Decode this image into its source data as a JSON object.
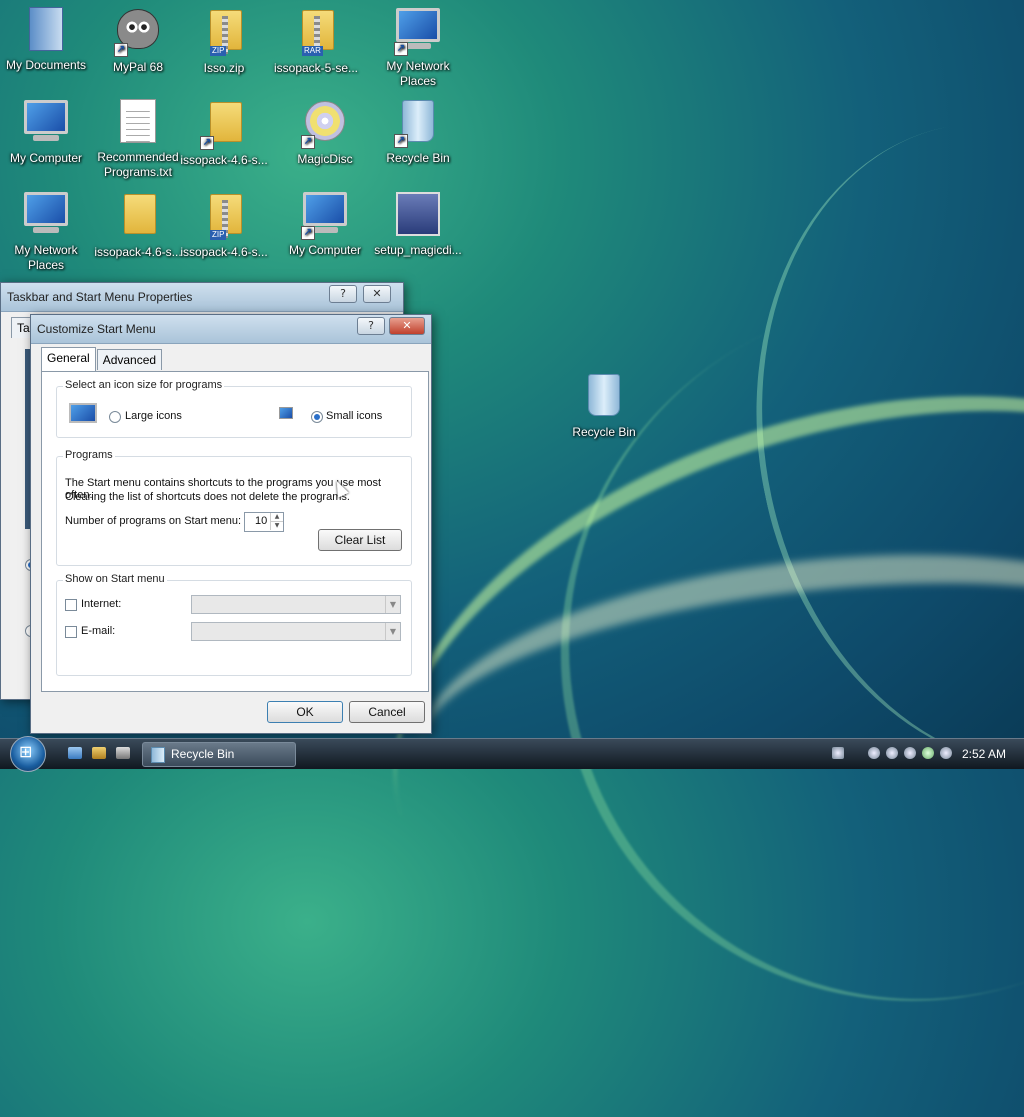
{
  "desktop": {
    "icons": [
      {
        "label": "My Documents"
      },
      {
        "label": "MyPal 68"
      },
      {
        "label": "Isso.zip"
      },
      {
        "label": "issopack-5-se..."
      },
      {
        "label": "My Network Places"
      },
      {
        "label": "My Computer"
      },
      {
        "label": "Recommended Programs.txt"
      },
      {
        "label": "issopack-4.6-s..."
      },
      {
        "label": "MagicDisc"
      },
      {
        "label": "Recycle Bin"
      },
      {
        "label": "My Network Places"
      },
      {
        "label": "issopack-4.6-s..."
      },
      {
        "label": "issopack-4.6-s..."
      },
      {
        "label": "My Computer"
      },
      {
        "label": "setup_magicdi..."
      },
      {
        "label": "Recycle Bin"
      }
    ],
    "zip_tag": "ZIP",
    "rar_tag": "RAR"
  },
  "back_window": {
    "title": "Taskbar and Start Menu Properties",
    "help": "?",
    "close": "✕",
    "tab_fragment": "Ta"
  },
  "dialog": {
    "title": "Customize Start Menu",
    "help": "?",
    "close": "✕",
    "tabs": [
      {
        "label": "General"
      },
      {
        "label": "Advanced"
      }
    ],
    "icon_size": {
      "heading": "Select an icon size for programs",
      "large": "Large icons",
      "small": "Small icons",
      "selected": "small"
    },
    "programs": {
      "heading": "Programs",
      "description_line1": "The Start menu contains shortcuts to the programs you use most often.",
      "description_line2": "Clearing the list of shortcuts does not delete the programs.",
      "count_label": "Number of programs on Start menu:",
      "count_value": "10",
      "clear_button": "Clear List"
    },
    "show": {
      "heading": "Show on Start menu",
      "internet": "Internet:",
      "email": "E-mail:"
    },
    "ok": "OK",
    "cancel": "Cancel"
  },
  "taskbar": {
    "task_label": "Recycle Bin",
    "clock": "2:52 AM"
  },
  "colors": {
    "accent": "#2a6fc9",
    "close_red": "#c0402c",
    "folder": "#e2b53c"
  }
}
